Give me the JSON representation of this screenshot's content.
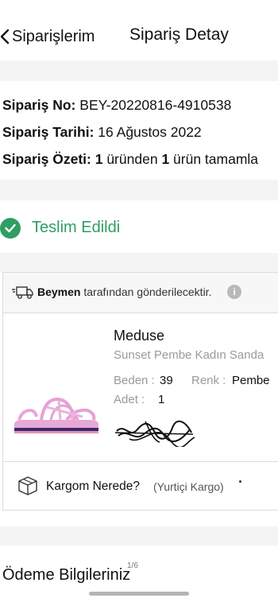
{
  "nav": {
    "back_label": "Siparişlerim",
    "title": "Sipariş Detay"
  },
  "summary": {
    "order_no_label": "Sipariş No:",
    "order_no_value": "BEY-20220816-4910538",
    "order_date_label": "Sipariş Tarihi:",
    "order_date_value": "16 Ağustos 2022",
    "order_summary_label": "Sipariş Özeti:",
    "order_summary_count1": "1",
    "order_summary_mid": "üründen",
    "order_summary_count2": "1",
    "order_summary_tail": "ürün tamamla"
  },
  "status": {
    "label": "Teslim Edildi",
    "color": "#2f9e63"
  },
  "shipment": {
    "seller": "Beymen",
    "seller_suffix": "tarafından gönderilecektir.",
    "info_icon": "i"
  },
  "product": {
    "brand": "Meduse",
    "name": "Sunset Pembe Kadın Sanda",
    "size_label": "Beden :",
    "size_value": "39",
    "color_label": "Renk :",
    "color_value": "Pembe",
    "qty_label": "Adet :",
    "qty_value": "1"
  },
  "cargo": {
    "label": "Kargom Nerede?",
    "carrier": "(Yurtiçi Kargo)"
  },
  "payment": {
    "title": "Ödeme Bilgileriniz",
    "mark": "1/6"
  }
}
